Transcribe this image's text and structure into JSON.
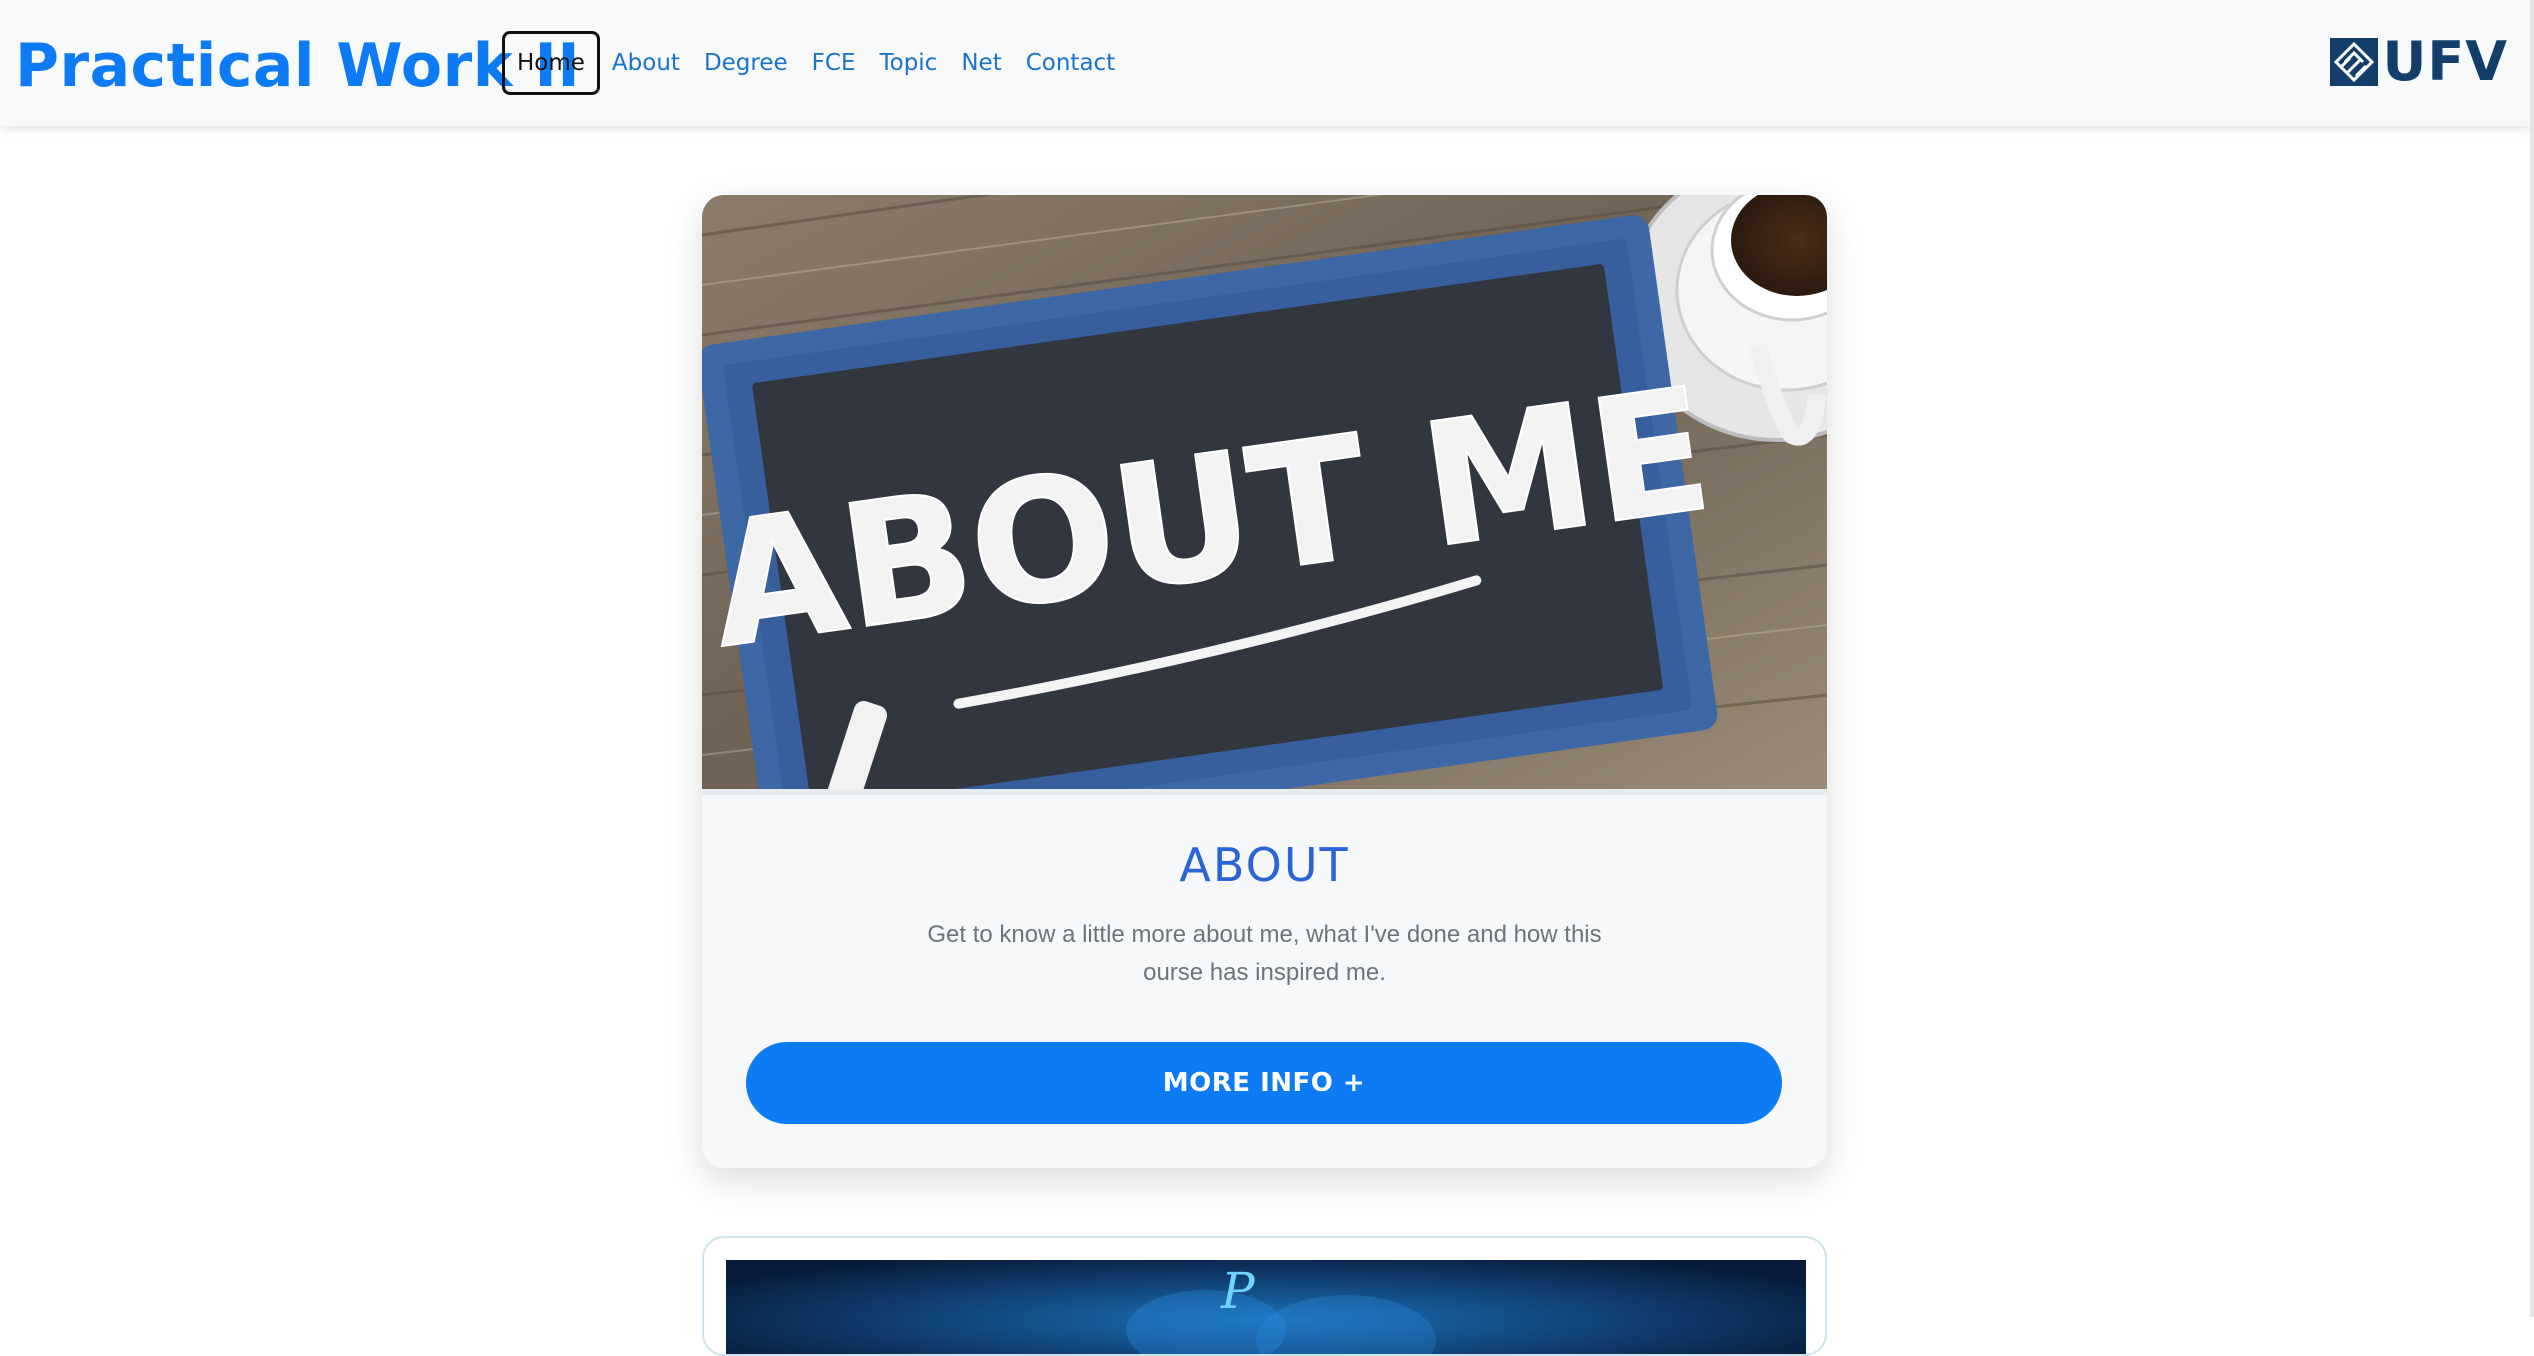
{
  "navbar": {
    "brand": "Practical Work II",
    "links": [
      {
        "label": "Home",
        "active": true
      },
      {
        "label": "About"
      },
      {
        "label": "Degree"
      },
      {
        "label": "FCE"
      },
      {
        "label": "Topic"
      },
      {
        "label": "Net"
      },
      {
        "label": "Contact"
      }
    ],
    "logo_text": "UFV"
  },
  "card": {
    "image_text": "ABOUT ME",
    "title": "ABOUT",
    "description": "Get to know a little more about me, what I've done and how this ourse has inspired me.",
    "button_label": "MORE INFO +"
  },
  "card2": {
    "image_letter": "P"
  },
  "colors": {
    "brand": "#0d7bf4",
    "nav_link": "#1a73c9",
    "title": "#2a64d6",
    "logo": "#133e6b",
    "button": "#0d7bf4"
  }
}
